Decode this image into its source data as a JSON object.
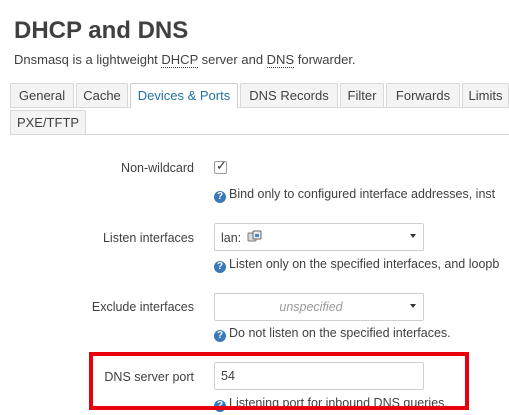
{
  "page": {
    "title": "DHCP and DNS",
    "description_parts": [
      "Dnsmasq is a lightweight ",
      "DHCP",
      " server and ",
      "DNS",
      " forwarder."
    ]
  },
  "tabs": {
    "row1": [
      "General",
      "Cache",
      "Devices & Ports",
      "DNS Records",
      "Filter",
      "Forwards",
      "Limits"
    ],
    "row2": [
      "PXE/TFTP"
    ],
    "active": "Devices & Ports"
  },
  "fields": {
    "non_wildcard": {
      "label": "Non-wildcard",
      "checked": true,
      "help": "Bind only to configured interface addresses, inst"
    },
    "listen_interfaces": {
      "label": "Listen interfaces",
      "value": "lan:",
      "help": "Listen only on the specified interfaces, and loopb"
    },
    "exclude_interfaces": {
      "label": "Exclude interfaces",
      "placeholder": "unspecified",
      "help": "Do not listen on the specified interfaces."
    },
    "dns_server_port": {
      "label": "DNS server port",
      "value": "54",
      "help": "Listening port for inbound DNS queries."
    }
  },
  "colors": {
    "accent": "#2071a4",
    "highlight_border": "#e8000d",
    "help_icon": "#3a79b8"
  },
  "icons": {
    "help": "question-circle-icon",
    "checkbox": "checkmark-icon",
    "network": "network-interface-icon",
    "dropdown": "caret-down-icon"
  }
}
